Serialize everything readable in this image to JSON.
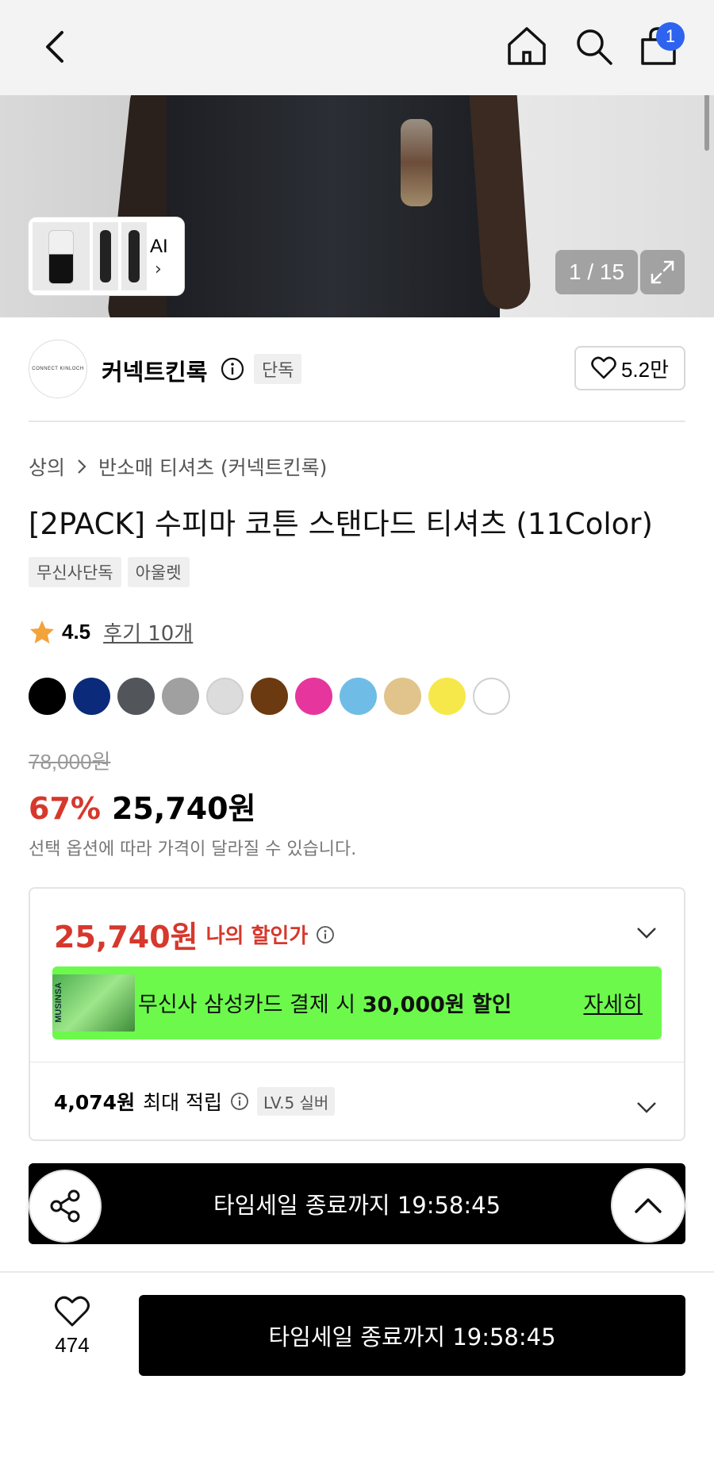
{
  "nav": {
    "cart_count": "1"
  },
  "gallery": {
    "ai_label": "AI",
    "counter": "1 / 15"
  },
  "brand": {
    "logo_text": "CONNECT KINLOCH",
    "name": "커넥트킨록",
    "tag": "단독",
    "likes": "5.2만"
  },
  "breadcrumb": {
    "category": "상의",
    "subcategory": "반소매 티셔츠 (커넥트킨록)"
  },
  "product": {
    "title": "[2PACK] 수피마 코튼 스탠다드 티셔츠 (11Color)",
    "tags": [
      "무신사단독",
      "아울렛"
    ],
    "rating": "4.5",
    "reviews": "후기 10개"
  },
  "colors": [
    "#000000",
    "#0b2a7a",
    "#52565b",
    "#a0a0a0",
    "#dcdcdc",
    "#6b3a10",
    "#e6369e",
    "#6fbde6",
    "#e1c48c",
    "#f6e84a",
    "#ffffff"
  ],
  "price": {
    "original": "78,000원",
    "rate": "67%",
    "sale": "25,740원",
    "note": "선택 옵션에 따라 가격이 달라질 수 있습니다."
  },
  "discount": {
    "my_price": "25,740원",
    "my_price_label": "나의 할인가",
    "banner_thumb": "MUSINSA",
    "banner_text": "무신사 삼성카드 결제 시 ",
    "banner_amount": "30,000원 할인",
    "banner_more": "자세히",
    "points_amount": "4,074원",
    "points_label": "최대 적립",
    "level": "LV.5 실버"
  },
  "timer": {
    "text": "타임세일 종료까지 19:58:45"
  },
  "bottom": {
    "likes": "474",
    "buy_text": "타임세일 종료까지 19:58:45"
  }
}
